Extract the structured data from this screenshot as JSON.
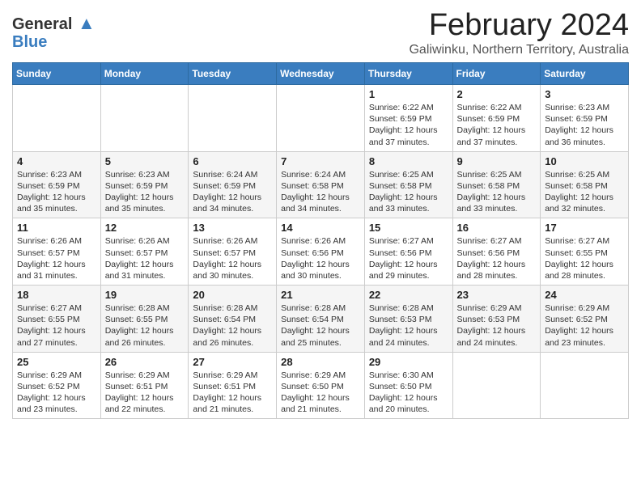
{
  "logo": {
    "general": "General",
    "blue": "Blue"
  },
  "title": "February 2024",
  "subtitle": "Galiwinku, Northern Territory, Australia",
  "days_of_week": [
    "Sunday",
    "Monday",
    "Tuesday",
    "Wednesday",
    "Thursday",
    "Friday",
    "Saturday"
  ],
  "weeks": [
    [
      {
        "day": "",
        "info": ""
      },
      {
        "day": "",
        "info": ""
      },
      {
        "day": "",
        "info": ""
      },
      {
        "day": "",
        "info": ""
      },
      {
        "day": "1",
        "info": "Sunrise: 6:22 AM\nSunset: 6:59 PM\nDaylight: 12 hours and 37 minutes."
      },
      {
        "day": "2",
        "info": "Sunrise: 6:22 AM\nSunset: 6:59 PM\nDaylight: 12 hours and 37 minutes."
      },
      {
        "day": "3",
        "info": "Sunrise: 6:23 AM\nSunset: 6:59 PM\nDaylight: 12 hours and 36 minutes."
      }
    ],
    [
      {
        "day": "4",
        "info": "Sunrise: 6:23 AM\nSunset: 6:59 PM\nDaylight: 12 hours and 35 minutes."
      },
      {
        "day": "5",
        "info": "Sunrise: 6:23 AM\nSunset: 6:59 PM\nDaylight: 12 hours and 35 minutes."
      },
      {
        "day": "6",
        "info": "Sunrise: 6:24 AM\nSunset: 6:59 PM\nDaylight: 12 hours and 34 minutes."
      },
      {
        "day": "7",
        "info": "Sunrise: 6:24 AM\nSunset: 6:58 PM\nDaylight: 12 hours and 34 minutes."
      },
      {
        "day": "8",
        "info": "Sunrise: 6:25 AM\nSunset: 6:58 PM\nDaylight: 12 hours and 33 minutes."
      },
      {
        "day": "9",
        "info": "Sunrise: 6:25 AM\nSunset: 6:58 PM\nDaylight: 12 hours and 33 minutes."
      },
      {
        "day": "10",
        "info": "Sunrise: 6:25 AM\nSunset: 6:58 PM\nDaylight: 12 hours and 32 minutes."
      }
    ],
    [
      {
        "day": "11",
        "info": "Sunrise: 6:26 AM\nSunset: 6:57 PM\nDaylight: 12 hours and 31 minutes."
      },
      {
        "day": "12",
        "info": "Sunrise: 6:26 AM\nSunset: 6:57 PM\nDaylight: 12 hours and 31 minutes."
      },
      {
        "day": "13",
        "info": "Sunrise: 6:26 AM\nSunset: 6:57 PM\nDaylight: 12 hours and 30 minutes."
      },
      {
        "day": "14",
        "info": "Sunrise: 6:26 AM\nSunset: 6:56 PM\nDaylight: 12 hours and 30 minutes."
      },
      {
        "day": "15",
        "info": "Sunrise: 6:27 AM\nSunset: 6:56 PM\nDaylight: 12 hours and 29 minutes."
      },
      {
        "day": "16",
        "info": "Sunrise: 6:27 AM\nSunset: 6:56 PM\nDaylight: 12 hours and 28 minutes."
      },
      {
        "day": "17",
        "info": "Sunrise: 6:27 AM\nSunset: 6:55 PM\nDaylight: 12 hours and 28 minutes."
      }
    ],
    [
      {
        "day": "18",
        "info": "Sunrise: 6:27 AM\nSunset: 6:55 PM\nDaylight: 12 hours and 27 minutes."
      },
      {
        "day": "19",
        "info": "Sunrise: 6:28 AM\nSunset: 6:55 PM\nDaylight: 12 hours and 26 minutes."
      },
      {
        "day": "20",
        "info": "Sunrise: 6:28 AM\nSunset: 6:54 PM\nDaylight: 12 hours and 26 minutes."
      },
      {
        "day": "21",
        "info": "Sunrise: 6:28 AM\nSunset: 6:54 PM\nDaylight: 12 hours and 25 minutes."
      },
      {
        "day": "22",
        "info": "Sunrise: 6:28 AM\nSunset: 6:53 PM\nDaylight: 12 hours and 24 minutes."
      },
      {
        "day": "23",
        "info": "Sunrise: 6:29 AM\nSunset: 6:53 PM\nDaylight: 12 hours and 24 minutes."
      },
      {
        "day": "24",
        "info": "Sunrise: 6:29 AM\nSunset: 6:52 PM\nDaylight: 12 hours and 23 minutes."
      }
    ],
    [
      {
        "day": "25",
        "info": "Sunrise: 6:29 AM\nSunset: 6:52 PM\nDaylight: 12 hours and 23 minutes."
      },
      {
        "day": "26",
        "info": "Sunrise: 6:29 AM\nSunset: 6:51 PM\nDaylight: 12 hours and 22 minutes."
      },
      {
        "day": "27",
        "info": "Sunrise: 6:29 AM\nSunset: 6:51 PM\nDaylight: 12 hours and 21 minutes."
      },
      {
        "day": "28",
        "info": "Sunrise: 6:29 AM\nSunset: 6:50 PM\nDaylight: 12 hours and 21 minutes."
      },
      {
        "day": "29",
        "info": "Sunrise: 6:30 AM\nSunset: 6:50 PM\nDaylight: 12 hours and 20 minutes."
      },
      {
        "day": "",
        "info": ""
      },
      {
        "day": "",
        "info": ""
      }
    ]
  ]
}
